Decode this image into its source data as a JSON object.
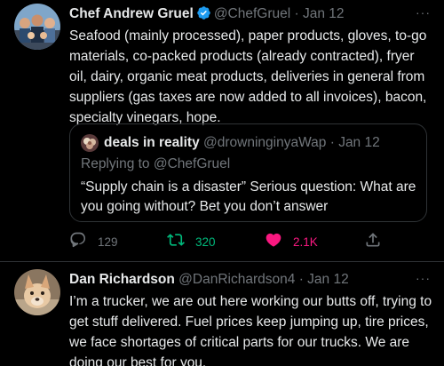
{
  "tweet1": {
    "display_name": "Chef Andrew Gruel",
    "handle": "@ChefGruel",
    "date": "Jan 12",
    "lines": [
      "Seafood (mainly processed), paper products, gloves, to-go",
      "materials, co-packed products (already contracted), fryer",
      "oil, dairy, organic meat products, deliveries in general from",
      "suppliers (gas taxes are now added to all invoices), bacon,",
      "specialty vinegars, hope."
    ],
    "more": "···"
  },
  "quote": {
    "display_name": "deals in reality",
    "handle": "@drowninginyaWap",
    "date": "Jan 12",
    "replying_to": "Replying to @ChefGruel",
    "lines": [
      "“Supply chain is a disaster” Serious question: What are",
      "you going without?  Bet you don’t answer"
    ]
  },
  "actions": {
    "reply_count": "129",
    "retweet_count": "320",
    "like_count": "2.1K"
  },
  "tweet2": {
    "display_name": "Dan Richardson",
    "handle": "@DanRichardson4",
    "date": "Jan 12",
    "lines": [
      "I’m a trucker, we are out here working our butts off, trying to",
      "get stuff delivered. Fuel prices keep jumping up, tire prices,",
      "we face shortages of critical parts for our trucks. We are",
      "doing our best for you."
    ],
    "more": "···"
  },
  "colors": {
    "background": "#000000",
    "text": "#e7e9ea",
    "muted": "#71767b",
    "verified": "#1d9bf0",
    "retweet": "#00ba7c",
    "like": "#f91880",
    "border": "#2f3336"
  },
  "separator": "·"
}
